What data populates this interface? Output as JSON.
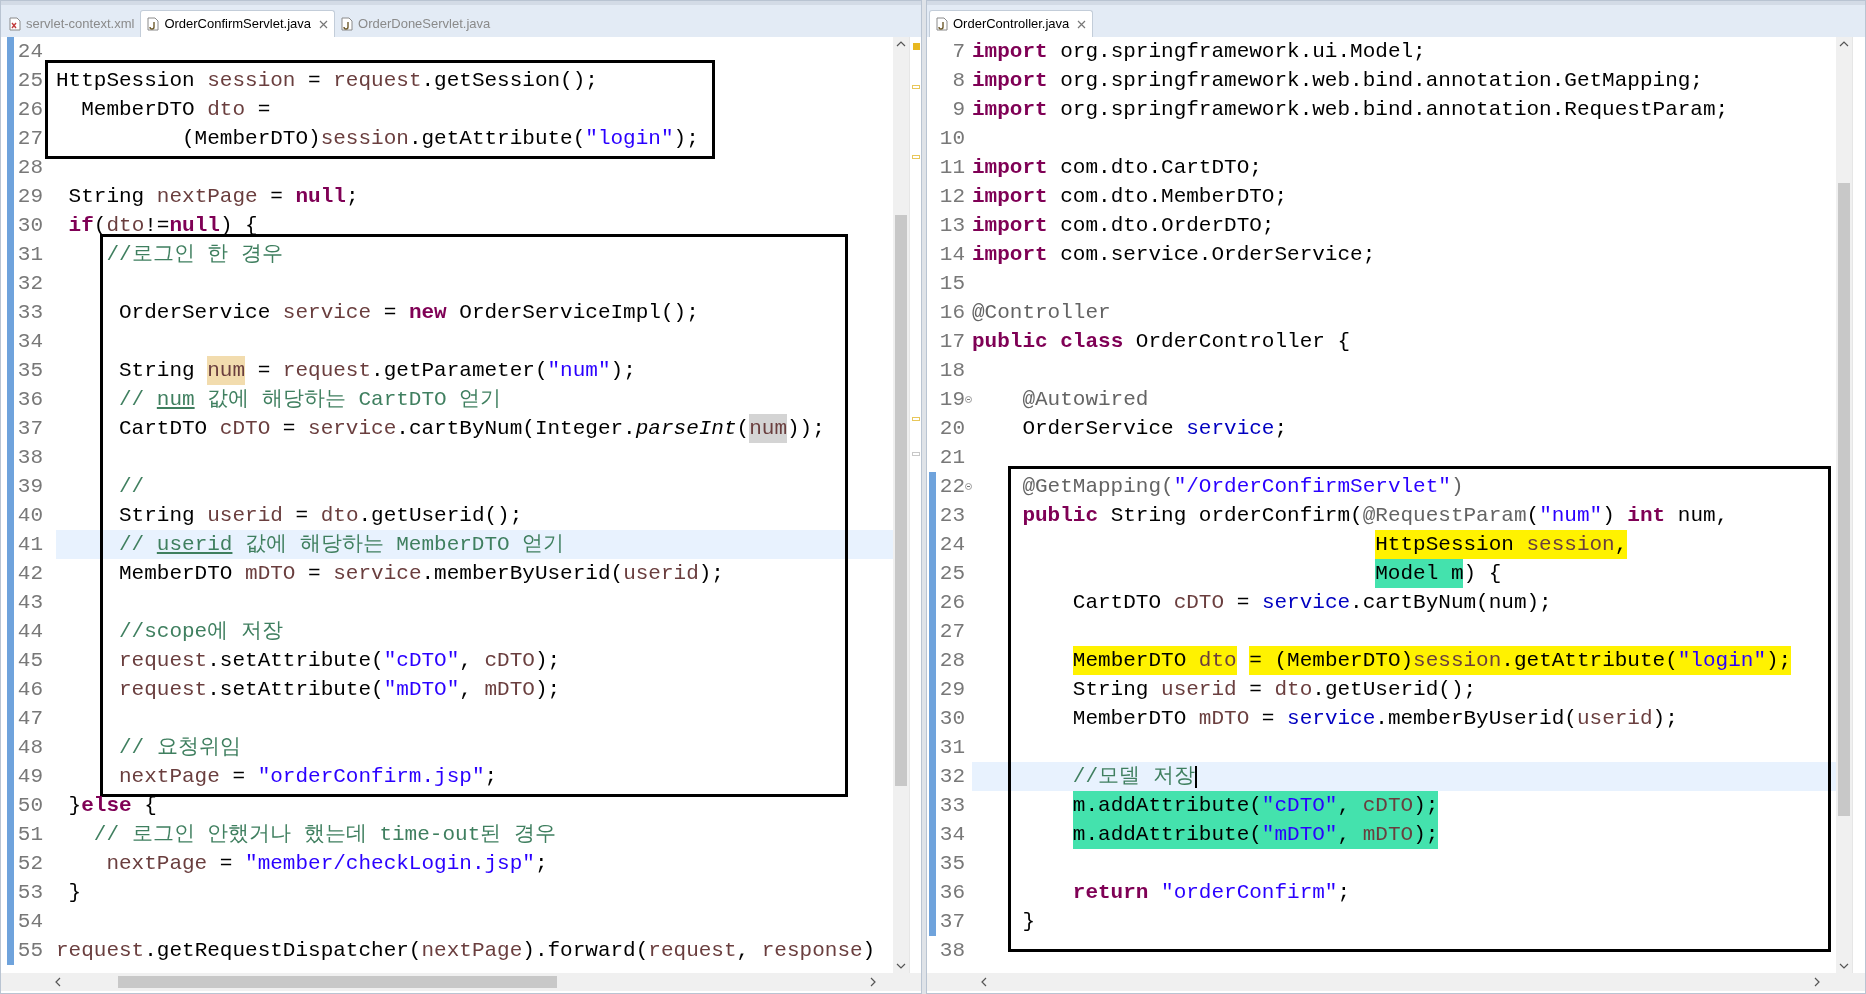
{
  "editors": [
    {
      "focused": false,
      "tabs": [
        {
          "label": "servlet-context.xml",
          "kind": "xml",
          "selected": false
        },
        {
          "label": "OrderConfirmServlet.java",
          "kind": "java",
          "selected": true
        },
        {
          "label": "OrderDoneServlet.java",
          "kind": "java",
          "selected": false
        }
      ],
      "lines": [
        {
          "number": "24",
          "changed": true,
          "current": false,
          "boxed": false
        },
        {
          "number": "25",
          "changed": true,
          "current": false,
          "boxed": true,
          "tokens": [
            {
              "text": "HttpSession ",
              "kind": "plain"
            },
            {
              "text": "session",
              "kind": "variable"
            },
            {
              "text": " = ",
              "kind": "plain"
            },
            {
              "text": "request",
              "kind": "variable"
            },
            {
              "text": ".getSession();",
              "kind": "plain"
            }
          ]
        },
        {
          "number": "26",
          "changed": true,
          "current": false,
          "boxed": true,
          "tokens": [
            {
              "text": "  MemberDTO ",
              "kind": "plain"
            },
            {
              "text": "dto",
              "kind": "variable"
            },
            {
              "text": " =",
              "kind": "plain"
            }
          ]
        },
        {
          "number": "27",
          "changed": true,
          "current": false,
          "boxed": true,
          "tokens": [
            {
              "text": "          (MemberDTO)",
              "kind": "plain"
            },
            {
              "text": "session",
              "kind": "variable"
            },
            {
              "text": ".getAttribute(",
              "kind": "plain"
            },
            {
              "text": "\"login\"",
              "kind": "string"
            },
            {
              "text": ");",
              "kind": "plain"
            }
          ]
        },
        {
          "number": "28",
          "changed": true,
          "current": false,
          "boxed": false
        },
        {
          "number": "29",
          "changed": true,
          "current": false,
          "boxed": false,
          "tokens": [
            {
              "text": " String ",
              "kind": "plain"
            },
            {
              "text": "nextPage",
              "kind": "variable"
            },
            {
              "text": " = ",
              "kind": "plain"
            },
            {
              "text": "null",
              "kind": "keyword"
            },
            {
              "text": ";",
              "kind": "plain"
            }
          ]
        },
        {
          "number": "30",
          "changed": true,
          "current": false,
          "boxed": false,
          "tokens": [
            {
              "text": " if",
              "kind": "keyword"
            },
            {
              "text": "(",
              "kind": "plain"
            },
            {
              "text": "dto",
              "kind": "variable"
            },
            {
              "text": "!=",
              "kind": "plain"
            },
            {
              "text": "null",
              "kind": "keyword"
            },
            {
              "text": ") {",
              "kind": "plain"
            }
          ]
        },
        {
          "number": "31",
          "changed": true,
          "current": false,
          "boxed": true,
          "tokens": [
            {
              "text": "    //로그인 한 경우",
              "kind": "comment"
            }
          ]
        },
        {
          "number": "32",
          "changed": true,
          "current": false,
          "boxed": true
        },
        {
          "number": "33",
          "changed": true,
          "current": false,
          "boxed": true,
          "tokens": [
            {
              "text": "     OrderService ",
              "kind": "plain"
            },
            {
              "text": "service",
              "kind": "variable"
            },
            {
              "text": " = ",
              "kind": "plain"
            },
            {
              "text": "new",
              "kind": "keyword"
            },
            {
              "text": " OrderServiceImpl();",
              "kind": "plain"
            }
          ]
        },
        {
          "number": "34",
          "changed": true,
          "current": false,
          "boxed": true
        },
        {
          "number": "35",
          "changed": true,
          "current": false,
          "boxed": true,
          "tokens": [
            {
              "text": "     String ",
              "kind": "plain"
            },
            {
              "text": "num",
              "kind": "variable",
              "color": "#f2dcae"
            },
            {
              "text": " = ",
              "kind": "plain"
            },
            {
              "text": "request",
              "kind": "variable"
            },
            {
              "text": ".getParameter(",
              "kind": "plain"
            },
            {
              "text": "\"num\"",
              "kind": "string"
            },
            {
              "text": ");",
              "kind": "plain"
            }
          ]
        },
        {
          "number": "36",
          "changed": true,
          "current": false,
          "boxed": true,
          "tokens": [
            {
              "text": "     // ",
              "kind": "comment"
            },
            {
              "text": "num",
              "kind": "comment-underlined"
            },
            {
              "text": " 값에 해당하는 CartDTO 얻기",
              "kind": "comment"
            }
          ]
        },
        {
          "number": "37",
          "changed": true,
          "current": false,
          "boxed": true,
          "tokens": [
            {
              "text": "     CartDTO ",
              "kind": "plain"
            },
            {
              "text": "cDTO",
              "kind": "variable"
            },
            {
              "text": " = ",
              "kind": "plain"
            },
            {
              "text": "service",
              "kind": "variable"
            },
            {
              "text": ".cartByNum(Integer.",
              "kind": "plain"
            },
            {
              "text": "parseInt",
              "kind": "italic"
            },
            {
              "text": "(",
              "kind": "plain"
            },
            {
              "text": "num",
              "kind": "variable",
              "color": "#d4d4d4"
            },
            {
              "text": "));",
              "kind": "plain"
            }
          ]
        },
        {
          "number": "38",
          "changed": true,
          "current": false,
          "boxed": true
        },
        {
          "number": "39",
          "changed": true,
          "current": false,
          "boxed": true,
          "tokens": [
            {
              "text": "     //",
              "kind": "comment"
            }
          ]
        },
        {
          "number": "40",
          "changed": true,
          "current": false,
          "boxed": true,
          "tokens": [
            {
              "text": "     String ",
              "kind": "plain"
            },
            {
              "text": "userid",
              "kind": "variable"
            },
            {
              "text": " = ",
              "kind": "plain"
            },
            {
              "text": "dto",
              "kind": "variable"
            },
            {
              "text": ".getUserid();",
              "kind": "plain"
            }
          ]
        },
        {
          "number": "41",
          "changed": true,
          "current": true,
          "boxed": true,
          "tokens": [
            {
              "text": "     // ",
              "kind": "comment"
            },
            {
              "text": "userid",
              "kind": "comment-underlined"
            },
            {
              "text": " 값에 해당하는 MemberDTO 얻기",
              "kind": "comment"
            }
          ]
        },
        {
          "number": "42",
          "changed": true,
          "current": false,
          "boxed": true,
          "tokens": [
            {
              "text": "     MemberDTO ",
              "kind": "plain"
            },
            {
              "text": "mDTO",
              "kind": "variable"
            },
            {
              "text": " = ",
              "kind": "plain"
            },
            {
              "text": "service",
              "kind": "variable"
            },
            {
              "text": ".memberByUserid(",
              "kind": "plain"
            },
            {
              "text": "userid",
              "kind": "variable"
            },
            {
              "text": ");",
              "kind": "plain"
            }
          ]
        },
        {
          "number": "43",
          "changed": true,
          "current": false,
          "boxed": true
        },
        {
          "number": "44",
          "changed": true,
          "current": false,
          "boxed": true,
          "tokens": [
            {
              "text": "     //scope에 저장",
              "kind": "comment"
            }
          ]
        },
        {
          "number": "45",
          "changed": true,
          "current": false,
          "boxed": true,
          "tokens": [
            {
              "text": "     request",
              "kind": "variable"
            },
            {
              "text": ".setAttribute(",
              "kind": "plain"
            },
            {
              "text": "\"cDTO\"",
              "kind": "string"
            },
            {
              "text": ", ",
              "kind": "plain"
            },
            {
              "text": "cDTO",
              "kind": "variable"
            },
            {
              "text": ");",
              "kind": "plain"
            }
          ]
        },
        {
          "number": "46",
          "changed": true,
          "current": false,
          "boxed": true,
          "tokens": [
            {
              "text": "     request",
              "kind": "variable"
            },
            {
              "text": ".setAttribute(",
              "kind": "plain"
            },
            {
              "text": "\"mDTO\"",
              "kind": "string"
            },
            {
              "text": ", ",
              "kind": "plain"
            },
            {
              "text": "mDTO",
              "kind": "variable"
            },
            {
              "text": ");",
              "kind": "plain"
            }
          ]
        },
        {
          "number": "47",
          "changed": true,
          "current": false,
          "boxed": true
        },
        {
          "number": "48",
          "changed": true,
          "current": false,
          "boxed": true,
          "tokens": [
            {
              "text": "     // 요청위임",
              "kind": "comment"
            }
          ]
        },
        {
          "number": "49",
          "changed": true,
          "current": false,
          "boxed": true,
          "tokens": [
            {
              "text": "     nextPage",
              "kind": "variable"
            },
            {
              "text": " = ",
              "kind": "plain"
            },
            {
              "text": "\"orderConfirm.jsp\"",
              "kind": "string"
            },
            {
              "text": ";",
              "kind": "plain"
            }
          ]
        },
        {
          "number": "50",
          "changed": true,
          "current": false,
          "boxed": false,
          "tokens": [
            {
              "text": " }",
              "kind": "plain"
            },
            {
              "text": "else",
              "kind": "keyword"
            },
            {
              "text": " {",
              "kind": "plain"
            }
          ]
        },
        {
          "number": "51",
          "changed": true,
          "current": false,
          "boxed": false,
          "tokens": [
            {
              "text": "   // 로그인 안했거나 했는데 time-out된 경우",
              "kind": "comment"
            }
          ]
        },
        {
          "number": "52",
          "changed": true,
          "current": false,
          "boxed": false,
          "tokens": [
            {
              "text": "    nextPage",
              "kind": "variable"
            },
            {
              "text": " = ",
              "kind": "plain"
            },
            {
              "text": "\"member/checkLogin.jsp\"",
              "kind": "string"
            },
            {
              "text": ";",
              "kind": "plain"
            }
          ]
        },
        {
          "number": "53",
          "changed": true,
          "current": false,
          "boxed": false,
          "tokens": [
            {
              "text": " }",
              "kind": "plain"
            }
          ]
        },
        {
          "number": "54",
          "changed": true,
          "current": false,
          "boxed": false
        },
        {
          "number": "55",
          "changed": true,
          "current": false,
          "boxed": false,
          "tokens": [
            {
              "text": "request",
              "kind": "variable"
            },
            {
              "text": ".getRequestDispatcher(",
              "kind": "plain"
            },
            {
              "text": "nextPage",
              "kind": "variable"
            },
            {
              "text": ").forward(",
              "kind": "plain"
            },
            {
              "text": "request",
              "kind": "variable"
            },
            {
              "text": ", ",
              "kind": "plain"
            },
            {
              "text": "response",
              "kind": "variable"
            },
            {
              "text": ")",
              "kind": "plain"
            }
          ]
        }
      ]
    },
    {
      "focused": true,
      "tabs": [
        {
          "label": "OrderController.java",
          "kind": "java",
          "selected": true
        }
      ],
      "lines": [
        {
          "number": "7",
          "changed": false,
          "current": false,
          "boxed": false,
          "tokens": [
            {
              "text": "import",
              "kind": "keyword"
            },
            {
              "text": " org.springframework.ui.Model;",
              "kind": "plain"
            }
          ]
        },
        {
          "number": "8",
          "changed": false,
          "current": false,
          "boxed": false,
          "tokens": [
            {
              "text": "import",
              "kind": "keyword"
            },
            {
              "text": " org.springframework.web.bind.annotation.GetMapping;",
              "kind": "plain"
            }
          ]
        },
        {
          "number": "9",
          "changed": false,
          "current": false,
          "boxed": false,
          "tokens": [
            {
              "text": "import",
              "kind": "keyword"
            },
            {
              "text": " org.springframework.web.bind.annotation.RequestParam;",
              "kind": "plain"
            }
          ]
        },
        {
          "number": "10",
          "changed": false,
          "current": false,
          "boxed": false
        },
        {
          "number": "11",
          "changed": false,
          "current": false,
          "boxed": false,
          "tokens": [
            {
              "text": "import",
              "kind": "keyword"
            },
            {
              "text": " com.dto.CartDTO;",
              "kind": "plain"
            }
          ]
        },
        {
          "number": "12",
          "changed": false,
          "current": false,
          "boxed": false,
          "tokens": [
            {
              "text": "import",
              "kind": "keyword"
            },
            {
              "text": " com.dto.MemberDTO;",
              "kind": "plain"
            }
          ]
        },
        {
          "number": "13",
          "changed": false,
          "current": false,
          "boxed": false,
          "tokens": [
            {
              "text": "import",
              "kind": "keyword"
            },
            {
              "text": " com.dto.OrderDTO;",
              "kind": "plain"
            }
          ]
        },
        {
          "number": "14",
          "changed": false,
          "current": false,
          "boxed": false,
          "tokens": [
            {
              "text": "import",
              "kind": "keyword"
            },
            {
              "text": " com.service.OrderService;",
              "kind": "plain"
            }
          ]
        },
        {
          "number": "15",
          "changed": false,
          "current": false,
          "boxed": false
        },
        {
          "number": "16",
          "changed": false,
          "current": false,
          "boxed": false,
          "tokens": [
            {
              "text": "@Controller",
              "kind": "annotation"
            }
          ]
        },
        {
          "number": "17",
          "changed": false,
          "current": false,
          "boxed": false,
          "tokens": [
            {
              "text": "public",
              "kind": "keyword"
            },
            {
              "text": " class",
              "kind": "keyword"
            },
            {
              "text": " OrderController {",
              "kind": "plain"
            }
          ]
        },
        {
          "number": "18",
          "changed": false,
          "current": false,
          "boxed": false
        },
        {
          "number": "19",
          "changed": false,
          "current": false,
          "boxed": false,
          "foldable": true,
          "tokens": [
            {
              "text": "    @Autowired",
              "kind": "annotation"
            }
          ]
        },
        {
          "number": "20",
          "changed": false,
          "current": false,
          "boxed": false,
          "tokens": [
            {
              "text": "    OrderService ",
              "kind": "plain"
            },
            {
              "text": "service",
              "kind": "field"
            },
            {
              "text": ";",
              "kind": "plain"
            }
          ]
        },
        {
          "number": "21",
          "changed": false,
          "current": false,
          "boxed": false
        },
        {
          "number": "22",
          "changed": true,
          "current": false,
          "boxed": true,
          "foldable": true,
          "tokens": [
            {
              "text": "    @GetMapping(",
              "kind": "annotation"
            },
            {
              "text": "\"/OrderConfirmServlet\"",
              "kind": "string"
            },
            {
              "text": ")",
              "kind": "annotation"
            }
          ]
        },
        {
          "number": "23",
          "changed": true,
          "current": false,
          "boxed": true,
          "tokens": [
            {
              "text": "    public",
              "kind": "keyword"
            },
            {
              "text": " String orderConfirm(",
              "kind": "plain"
            },
            {
              "text": "@RequestParam",
              "kind": "annotation"
            },
            {
              "text": "(",
              "kind": "plain"
            },
            {
              "text": "\"num\"",
              "kind": "string"
            },
            {
              "text": ") ",
              "kind": "plain"
            },
            {
              "text": "int",
              "kind": "keyword"
            },
            {
              "text": " num,",
              "kind": "plain"
            }
          ]
        },
        {
          "number": "24",
          "changed": true,
          "current": false,
          "boxed": true,
          "tokens": [
            {
              "text": "                                HttpSession ",
              "kind": "plain",
              "color": "#fff200"
            },
            {
              "text": "session",
              "kind": "variable",
              "color": "#fff200"
            },
            {
              "text": ",",
              "kind": "plain",
              "color": "#fff200"
            }
          ]
        },
        {
          "number": "25",
          "changed": true,
          "current": false,
          "boxed": true,
          "tokens": [
            {
              "text": "                                Model m",
              "kind": "plain",
              "color": "#44e2ad"
            },
            {
              "text": ") {",
              "kind": "plain"
            }
          ]
        },
        {
          "number": "26",
          "changed": true,
          "current": false,
          "boxed": true,
          "tokens": [
            {
              "text": "        CartDTO ",
              "kind": "plain"
            },
            {
              "text": "cDTO",
              "kind": "variable"
            },
            {
              "text": " = ",
              "kind": "plain"
            },
            {
              "text": "service",
              "kind": "field"
            },
            {
              "text": ".cartByNum(num);",
              "kind": "plain"
            }
          ]
        },
        {
          "number": "27",
          "changed": true,
          "current": false,
          "boxed": true
        },
        {
          "number": "28",
          "changed": true,
          "current": false,
          "boxed": true,
          "tokens": [
            {
              "text": "        MemberDTO ",
              "kind": "plain",
              "color": "#fff200"
            },
            {
              "text": "dto",
              "kind": "variable",
              "color": "#fff200"
            },
            {
              "text": " = (MemberDTO)",
              "kind": "plain",
              "color": "#fff200"
            },
            {
              "text": "session",
              "kind": "variable",
              "color": "#fff200"
            },
            {
              "text": ".getAttribute(",
              "kind": "plain",
              "color": "#fff200"
            },
            {
              "text": "\"login\"",
              "kind": "string",
              "color": "#fff200"
            },
            {
              "text": ");",
              "kind": "plain",
              "color": "#fff200"
            }
          ]
        },
        {
          "number": "29",
          "changed": true,
          "current": false,
          "boxed": true,
          "tokens": [
            {
              "text": "        String ",
              "kind": "plain"
            },
            {
              "text": "userid",
              "kind": "variable"
            },
            {
              "text": " = ",
              "kind": "plain"
            },
            {
              "text": "dto",
              "kind": "variable"
            },
            {
              "text": ".getUserid();",
              "kind": "plain"
            }
          ]
        },
        {
          "number": "30",
          "changed": true,
          "current": false,
          "boxed": true,
          "tokens": [
            {
              "text": "        MemberDTO ",
              "kind": "plain"
            },
            {
              "text": "mDTO",
              "kind": "variable"
            },
            {
              "text": " = ",
              "kind": "plain"
            },
            {
              "text": "service",
              "kind": "field"
            },
            {
              "text": ".memberByUserid(",
              "kind": "plain"
            },
            {
              "text": "userid",
              "kind": "variable"
            },
            {
              "text": ");",
              "kind": "plain"
            }
          ]
        },
        {
          "number": "31",
          "changed": true,
          "current": false,
          "boxed": true
        },
        {
          "number": "32",
          "changed": true,
          "current": true,
          "boxed": true,
          "tokens": [
            {
              "text": "        //모델 저장",
              "kind": "comment"
            }
          ]
        },
        {
          "number": "33",
          "changed": true,
          "current": false,
          "boxed": true,
          "tokens": [
            {
              "text": "        m.addAttribute(",
              "kind": "plain",
              "color": "#44e2ad"
            },
            {
              "text": "\"cDTO\"",
              "kind": "string",
              "color": "#44e2ad"
            },
            {
              "text": ", ",
              "kind": "plain",
              "color": "#44e2ad"
            },
            {
              "text": "cDTO",
              "kind": "variable",
              "color": "#44e2ad"
            },
            {
              "text": ");",
              "kind": "plain",
              "color": "#44e2ad"
            }
          ]
        },
        {
          "number": "34",
          "changed": true,
          "current": false,
          "boxed": true,
          "tokens": [
            {
              "text": "        m.addAttribute(",
              "kind": "plain",
              "color": "#44e2ad"
            },
            {
              "text": "\"mDTO\"",
              "kind": "string",
              "color": "#44e2ad"
            },
            {
              "text": ", ",
              "kind": "plain",
              "color": "#44e2ad"
            },
            {
              "text": "mDTO",
              "kind": "variable",
              "color": "#44e2ad"
            },
            {
              "text": ");",
              "kind": "plain",
              "color": "#44e2ad"
            }
          ]
        },
        {
          "number": "35",
          "changed": true,
          "current": false,
          "boxed": true
        },
        {
          "number": "36",
          "changed": true,
          "current": false,
          "boxed": true,
          "tokens": [
            {
              "text": "        return",
              "kind": "keyword"
            },
            {
              "text": " \"orderConfirm\"",
              "kind": "string"
            },
            {
              "text": ";",
              "kind": "plain"
            }
          ]
        },
        {
          "number": "37",
          "changed": true,
          "current": false,
          "boxed": true,
          "tokens": [
            {
              "text": "    }",
              "kind": "plain"
            }
          ]
        },
        {
          "number": "38",
          "changed": false,
          "current": false,
          "boxed": true
        }
      ]
    }
  ]
}
